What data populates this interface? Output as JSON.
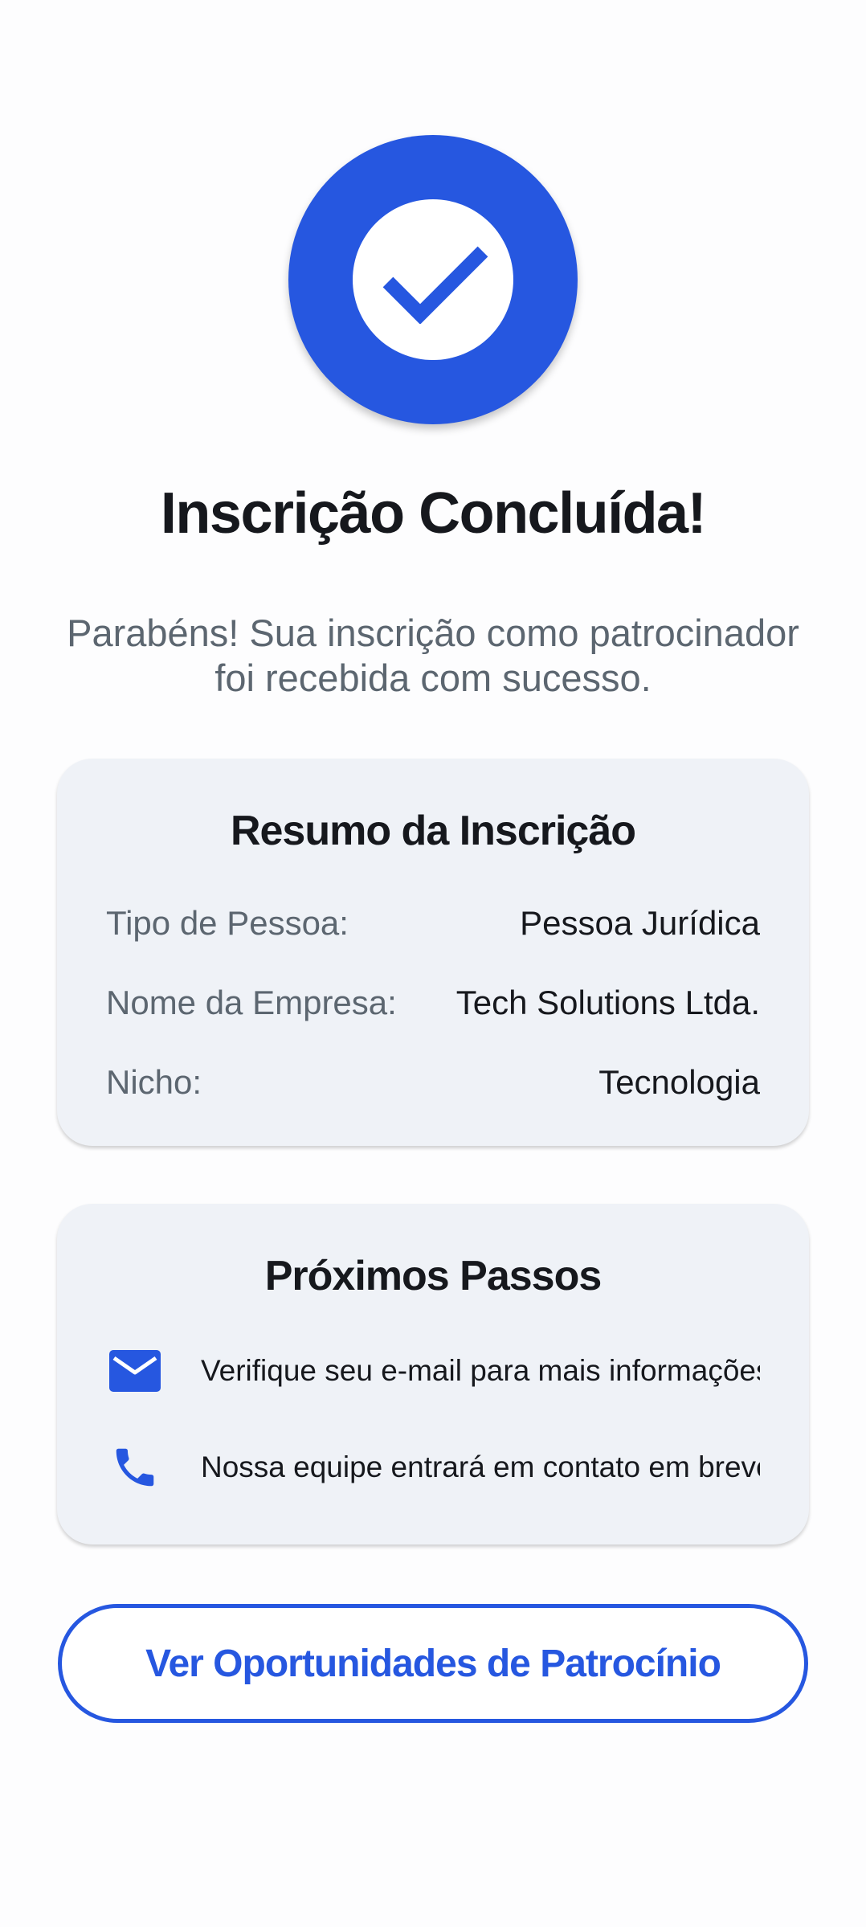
{
  "success": {
    "icon": "check-icon",
    "title": "Inscrição Concluída!",
    "message": "Parabéns! Sua inscrição como patrocinador foi recebida com sucesso."
  },
  "summary": {
    "title": "Resumo da Inscrição",
    "rows": [
      {
        "label": "Tipo de Pessoa:",
        "value": "Pessoa Jurídica"
      },
      {
        "label": "Nome da Empresa:",
        "value": "Tech Solutions Ltda."
      },
      {
        "label": "Nicho:",
        "value": "Tecnologia"
      }
    ]
  },
  "next_steps": {
    "title": "Próximos Passos",
    "items": [
      {
        "icon": "email-icon",
        "text": "Verifique seu e-mail para mais informações"
      },
      {
        "icon": "phone-icon",
        "text": "Nossa equipe entrará em contato em breve"
      }
    ]
  },
  "cta": {
    "label": "Ver Oportunidades de Patrocínio"
  },
  "colors": {
    "primary": "#2657e0",
    "card_bg": "#eff2f7",
    "text": "#16181d",
    "muted": "#5c6670"
  }
}
